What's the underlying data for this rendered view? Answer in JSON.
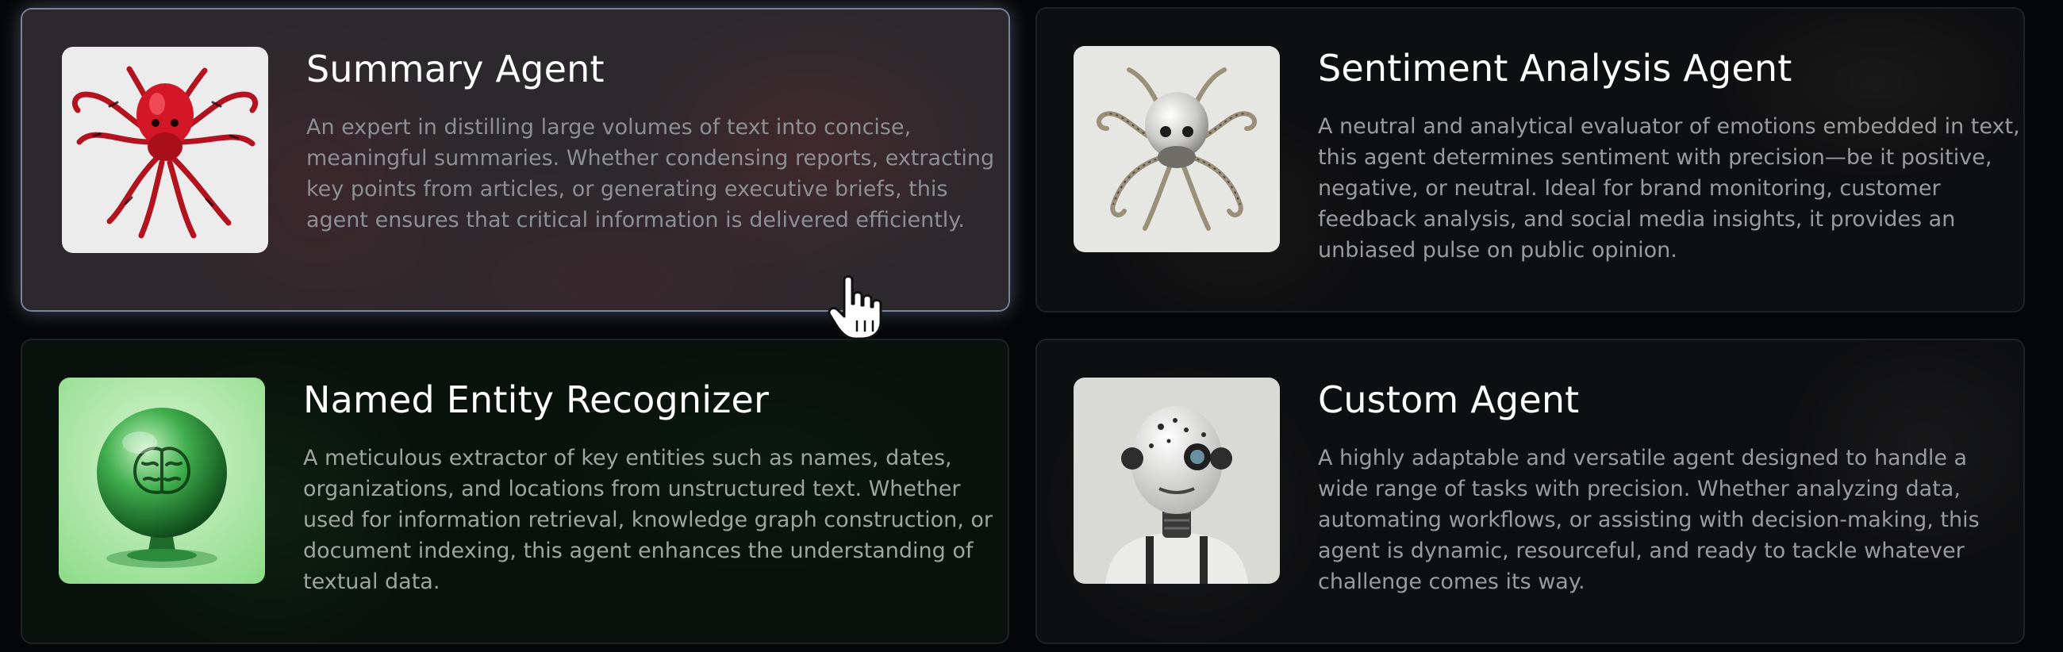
{
  "agents": [
    {
      "title": "Summary Agent",
      "description": "An expert in distilling large volumes of text into concise, meaningful summaries. Whether condensing reports, extracting key points from articles, or generating executive briefs, this agent ensures that critical information is delivered efficiently.",
      "thumbnail_icon": "red-octopus-robot-icon",
      "accent": "#c9172a",
      "state": "hover"
    },
    {
      "title": "Sentiment Analysis Agent",
      "description": "A neutral and analytical evaluator of emotions embedded in text, this agent determines sentiment with precision—be it positive, negative, or neutral. Ideal for brand monitoring, customer feedback analysis, and social media insights, it provides an unbiased pulse on public opinion.",
      "thumbnail_icon": "silver-octopus-robot-icon",
      "accent": "#c8c7c2"
    },
    {
      "title": "Named Entity Recognizer",
      "description": "A meticulous extractor of key entities such as names, dates, organizations, and locations from unstructured text. Whether used for information retrieval, knowledge graph construction, or document indexing, this agent enhances the understanding of textual data.",
      "thumbnail_icon": "glass-brain-orb-icon",
      "accent": "#2fa84a"
    },
    {
      "title": "Custom Agent",
      "description": "A highly adaptable and versatile agent designed to handle a wide range of tasks with precision. Whether analyzing data, automating workflows, or assisting with decision-making, this agent is dynamic, resourceful, and ready to tackle whatever challenge comes its way.",
      "thumbnail_icon": "white-humanoid-robot-icon",
      "accent": "#e9e9e9"
    }
  ],
  "cursor": {
    "icon": "hand-pointer-icon"
  }
}
